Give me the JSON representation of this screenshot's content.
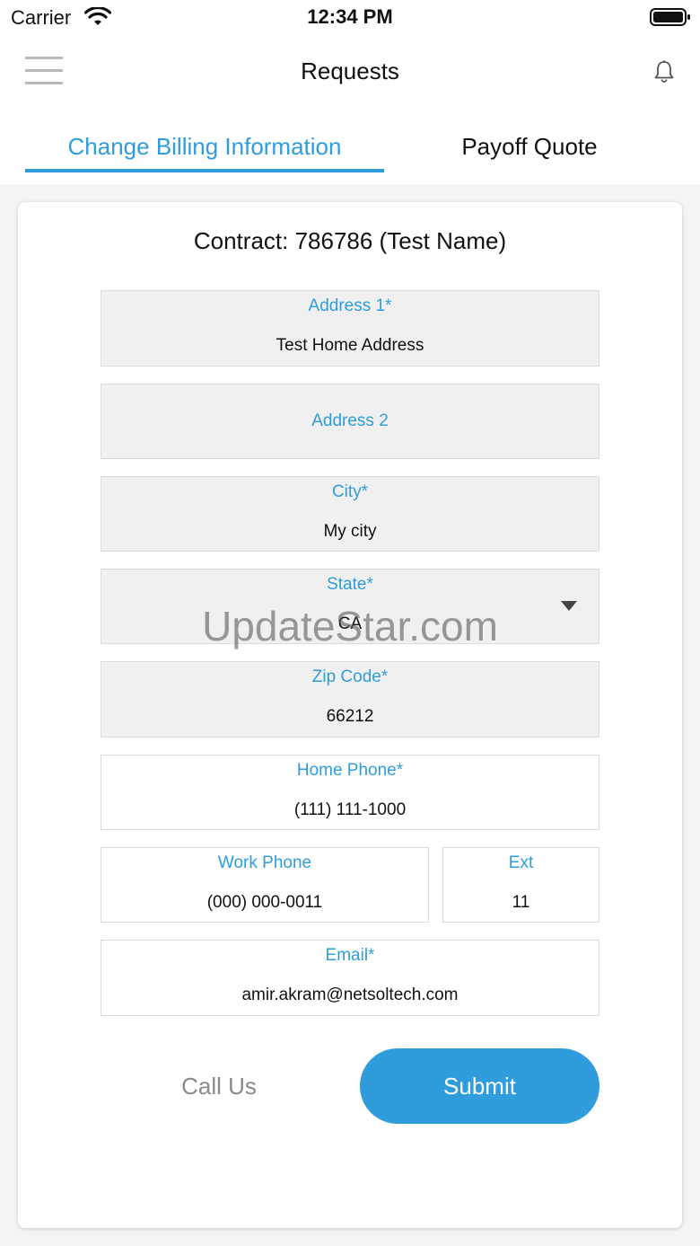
{
  "status_bar": {
    "carrier": "Carrier",
    "time": "12:34 PM"
  },
  "nav": {
    "title": "Requests"
  },
  "tabs": [
    {
      "label": "Change Billing Information",
      "active": true
    },
    {
      "label": "Payoff Quote",
      "active": false
    }
  ],
  "contract": {
    "heading": "Contract: 786786 (Test Name)"
  },
  "form": {
    "address1": {
      "label": "Address 1*",
      "value": "Test Home Address"
    },
    "address2": {
      "label": "Address 2",
      "value": ""
    },
    "city": {
      "label": "City*",
      "value": "My city"
    },
    "state": {
      "label": "State*",
      "value": "CA"
    },
    "zip": {
      "label": "Zip Code*",
      "value": "66212"
    },
    "home_phone": {
      "label": "Home Phone*",
      "value": "(111) 111-1000"
    },
    "work_phone": {
      "label": "Work Phone",
      "value": "(000) 000-0011"
    },
    "ext": {
      "label": "Ext",
      "value": "11"
    },
    "email": {
      "label": "Email*",
      "value": "amir.akram@netsoltech.com"
    }
  },
  "actions": {
    "call_us": "Call Us",
    "submit": "Submit"
  },
  "watermark": "UpdateStar.com",
  "colors": {
    "accent": "#2f9cdb",
    "field_bg": "#f0f0f0",
    "muted": "#8a8a8a"
  },
  "icons": {
    "menu": "hamburger-icon",
    "notifications": "bell-icon",
    "wifi": "wifi-icon",
    "battery": "battery-icon",
    "dropdown": "chevron-down-icon"
  }
}
